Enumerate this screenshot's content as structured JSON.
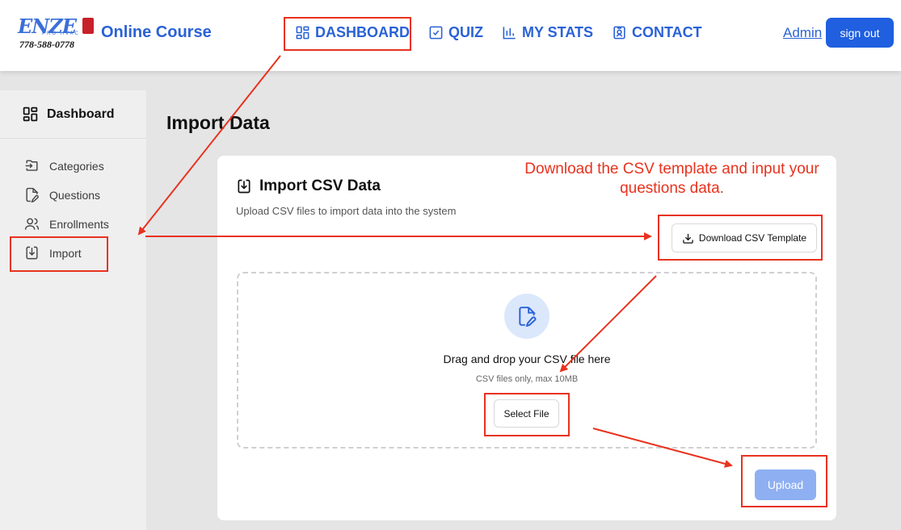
{
  "header": {
    "logo_text": "ENZE",
    "logo_sub": "PRO HVAC",
    "logo_phone": "778-588-0778",
    "brand": "Online Course",
    "nav": [
      {
        "label": "DASHBOARD",
        "icon": "dashboard-icon"
      },
      {
        "label": "QUIZ",
        "icon": "checkbox-icon"
      },
      {
        "label": "MY STATS",
        "icon": "bar-chart-icon"
      },
      {
        "label": "CONTACT",
        "icon": "contact-badge-icon"
      }
    ],
    "admin_label": "Admin",
    "signout_label": "sign out"
  },
  "sidebar": {
    "title": "Dashboard",
    "items": [
      {
        "label": "Categories",
        "icon": "folder-input-icon"
      },
      {
        "label": "Questions",
        "icon": "file-edit-icon"
      },
      {
        "label": "Enrollments",
        "icon": "users-icon"
      },
      {
        "label": "Import",
        "icon": "import-icon"
      }
    ]
  },
  "main": {
    "page_title": "Import Data",
    "card_title": "Import CSV Data",
    "card_desc": "Upload CSV files to import data into the system",
    "download_label": "Download CSV Template",
    "dropzone_title": "Drag and drop your CSV file here",
    "dropzone_sub": "CSV files only, max 10MB",
    "select_label": "Select File",
    "upload_label": "Upload"
  },
  "annotation": {
    "note": "Download the CSV template and input your questions data.",
    "color": "#e8321e"
  },
  "colors": {
    "accent": "#2a62d6",
    "primary_button": "#1f5fe0",
    "disabled_button": "#8eb0f2",
    "page_bg": "#e5e5e6",
    "sidebar_bg": "#efeff0"
  }
}
